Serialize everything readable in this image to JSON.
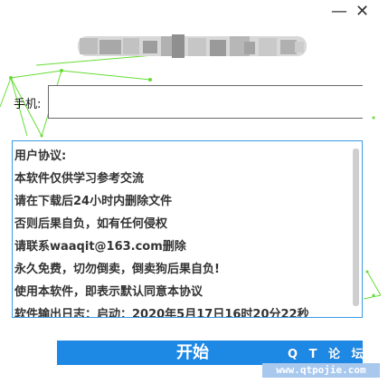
{
  "window": {
    "minimize_glyph": "—",
    "close_glyph": "✕",
    "background": "#ffffff"
  },
  "phone": {
    "label": "手机:",
    "value": ""
  },
  "agreement": {
    "lines": [
      "用户协议:",
      "本软件仅供学习参考交流",
      "请在下载后24小时内删除文件",
      "否则后果自负，如有任何侵权",
      "请联系waaqit@163.com删除",
      "永久免费，切勿倒卖，倒卖狗后果自负!",
      "使用本软件，即表示默认同意本协议",
      "软件输出日志：启动：2020年5月17日16时20分22秒"
    ]
  },
  "start_button": {
    "label": "开始",
    "color": "#1e88e5"
  },
  "watermark": {
    "line1": "Q T 论 坛",
    "line2": "www.qtpojie.com"
  },
  "colors": {
    "accent": "#1e88e5",
    "network": "#66dd33",
    "border": "#3b9ae6"
  }
}
